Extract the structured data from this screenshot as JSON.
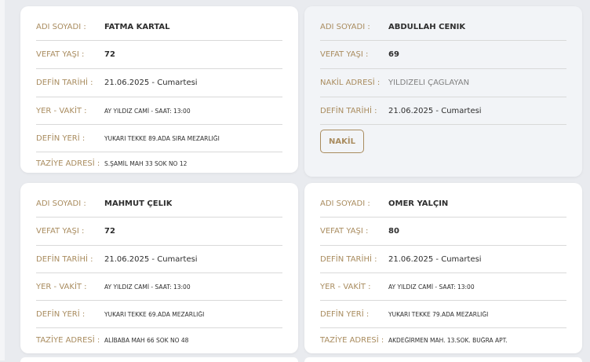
{
  "labels": {
    "name": "ADI SOYADI :",
    "age": "VEFAT YAŞI :",
    "burial_date": "DEFİN TARİHİ :",
    "place_time": "YER - VAKİT :",
    "burial_place": "DEFİN YERİ :",
    "condolence": "TAZİYE ADRESİ :",
    "transfer": "NAKİL ADRESİ :"
  },
  "cards": [
    {
      "name": "FATMA KARTAL",
      "age": "72",
      "burial_date": "21.06.2025 - Cumartesi",
      "place_time": "AY YILDIZ CAMİ - SAAT: 13:00",
      "burial_place": "YUKARI TEKKE 89.ADA SIRA MEZARLIĞI",
      "condolence": "S.ŞAMİL MAH 33 SOK NO 12"
    },
    {
      "name": "ABDULLAH CENİK",
      "age": "69",
      "transfer": "YILDIZELİ ÇAĞLAYAN",
      "burial_date": "21.06.2025 - Cumartesi",
      "button": "NAKİL"
    },
    {
      "name": "MAHMUT ÇELİK",
      "age": "72",
      "burial_date": "21.06.2025 - Cumartesi",
      "place_time": "AY YILDIZ CAMİ - SAAT: 13:00",
      "burial_place": "YUKARI TEKKE 69.ADA MEZARLIĞI",
      "condolence": "ALİBABA MAH 66 SOK NO 48"
    },
    {
      "name": "ÖMER YALÇIN",
      "age": "80",
      "burial_date": "21.06.2025 - Cumartesi",
      "place_time": "AY YILDIZ CAMİ - SAAT: 13:00",
      "burial_place": "YUKARI TEKKE 79.ADA MEZARLIĞI",
      "condolence": "AKDEĞİRMEN MAH. 13.SOK. BUĞRA APT."
    }
  ]
}
